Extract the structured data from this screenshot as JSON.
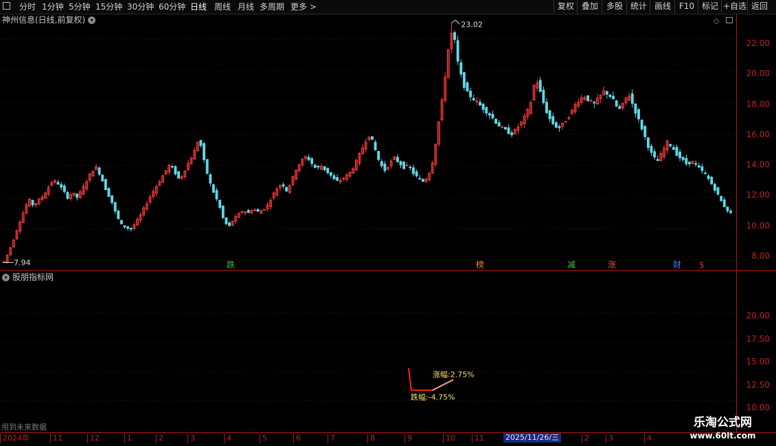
{
  "toolbar": {
    "timeframes": [
      {
        "label": "分时"
      },
      {
        "label": "1分钟"
      },
      {
        "label": "5分钟"
      },
      {
        "label": "15分钟"
      },
      {
        "label": "30分钟"
      },
      {
        "label": "60分钟"
      },
      {
        "label": "日线"
      },
      {
        "label": "周线"
      },
      {
        "label": "月线"
      },
      {
        "label": "多周期"
      },
      {
        "label": "更多 >"
      }
    ],
    "right_buttons": [
      {
        "label": "复权"
      },
      {
        "label": "叠加"
      },
      {
        "label": "多股"
      },
      {
        "label": "统计"
      },
      {
        "label": "画线"
      },
      {
        "label": "F10"
      },
      {
        "label": "标记"
      },
      {
        "label": "+自选"
      },
      {
        "label": "返回"
      }
    ],
    "square_icon": "square-outline-icon"
  },
  "main_pane": {
    "title": "神州信息(日线,前复权)",
    "menu_icon": "chevron-down-icon",
    "high_label": "23.02",
    "low_label": "7.94",
    "price_axis": [
      "22.00",
      "20.00",
      "18.00",
      "16.00",
      "14.00",
      "12.00",
      "10.00",
      "8.00"
    ],
    "event_markers": [
      {
        "label": "跌",
        "color": "#3ec23e"
      },
      {
        "label": "榜",
        "color": "#e08a2a"
      },
      {
        "label": "减",
        "color": "#3ec23e"
      },
      {
        "label": "涨",
        "color": "#e05050"
      },
      {
        "label": "财",
        "color": "#3a7cff"
      },
      {
        "label": "$",
        "color": "#e02020"
      }
    ],
    "icons": [
      "diamond-outline-icon",
      "resize-icon"
    ]
  },
  "sub_pane": {
    "title": "股朋指标网",
    "menu_icon": "chevron-down-icon",
    "axis": [
      "20.00",
      "17.50",
      "15.00",
      "12.50",
      "10.00"
    ],
    "rise_label": "涨幅:2.75%",
    "fall_label": "跌幅:-4.75%",
    "future_data_label": "用到未来数据"
  },
  "date_bar": {
    "ticks": [
      "2024年",
      "11",
      "12",
      "1",
      "2",
      "3",
      "4",
      "5",
      "6",
      "7",
      "8",
      "9",
      "10",
      "11",
      "2",
      "3",
      "4"
    ],
    "highlight": "2025/11/26/三"
  },
  "watermark": {
    "title": "乐淘公式网",
    "url": "www.60lt.com"
  },
  "colors": {
    "up": "#ff3b3b",
    "down": "#5fd9e8",
    "axis": "#c02020",
    "grid": "#5a0f0f",
    "background": "#000000"
  },
  "chart_data": [
    {
      "type": "candlestick",
      "title": "神州信息(日线,前复权)",
      "y_ticks": [
        8,
        10,
        12,
        14,
        16,
        18,
        20,
        22
      ],
      "ylim": [
        7.4,
        23.6
      ],
      "high": 23.02,
      "low": 7.94,
      "close_path": [
        7.94,
        8.6,
        9.4,
        10.3,
        11.1,
        11.9,
        11.5,
        11.8,
        12.1,
        12.6,
        13.1,
        12.9,
        12.5,
        12.0,
        12.3,
        12.0,
        12.5,
        13.1,
        13.7,
        13.9,
        13.2,
        12.4,
        11.8,
        10.9,
        10.3,
        10.1,
        10.0,
        10.4,
        10.9,
        11.5,
        12.1,
        12.6,
        13.1,
        13.6,
        14.1,
        13.6,
        13.1,
        13.7,
        14.3,
        14.9,
        15.8,
        14.3,
        13.1,
        12.3,
        11.6,
        10.6,
        10.1,
        10.6,
        10.9,
        11.2,
        11.0,
        11.3,
        11.1,
        11.2,
        11.5,
        12.1,
        12.6,
        12.9,
        12.4,
        13.1,
        13.9,
        14.3,
        14.6,
        14.2,
        13.8,
        14.0,
        13.7,
        13.4,
        13.0,
        13.1,
        13.3,
        13.6,
        14.1,
        14.8,
        15.5,
        16.0,
        15.1,
        14.2,
        13.7,
        14.1,
        14.5,
        14.2,
        13.9,
        14.0,
        13.5,
        13.2,
        13.0,
        13.4,
        14.4,
        16.5,
        18.5,
        21.2,
        22.7,
        20.6,
        19.3,
        18.6,
        18.3,
        18.0,
        17.7,
        17.4,
        17.1,
        16.7,
        16.4,
        16.2,
        16.0,
        16.3,
        16.7,
        17.2,
        18.0,
        19.6,
        18.6,
        17.6,
        16.9,
        16.5,
        16.4,
        16.8,
        17.2,
        17.8,
        18.2,
        18.4,
        18.1,
        17.9,
        18.3,
        18.7,
        18.5,
        18.1,
        17.5,
        17.9,
        18.6,
        17.8,
        17.0,
        16.2,
        15.3,
        14.6,
        14.3,
        14.9,
        15.5,
        15.2,
        14.7,
        14.4,
        14.1,
        14.3,
        14.0,
        13.7,
        13.4,
        12.9,
        12.4,
        11.8,
        11.3,
        11.0
      ]
    },
    {
      "type": "line",
      "title": "股朋指标网",
      "y_ticks": [
        10,
        12.5,
        15,
        17.5,
        20
      ],
      "ylim": [
        9.8,
        23.6
      ],
      "series": [
        {
          "values": [
            15.3,
            13.4,
            13.4
          ],
          "color": "#ff2020"
        },
        {
          "values": [
            13.4,
            14.3
          ],
          "color": "#ff9a9a"
        }
      ]
    }
  ]
}
